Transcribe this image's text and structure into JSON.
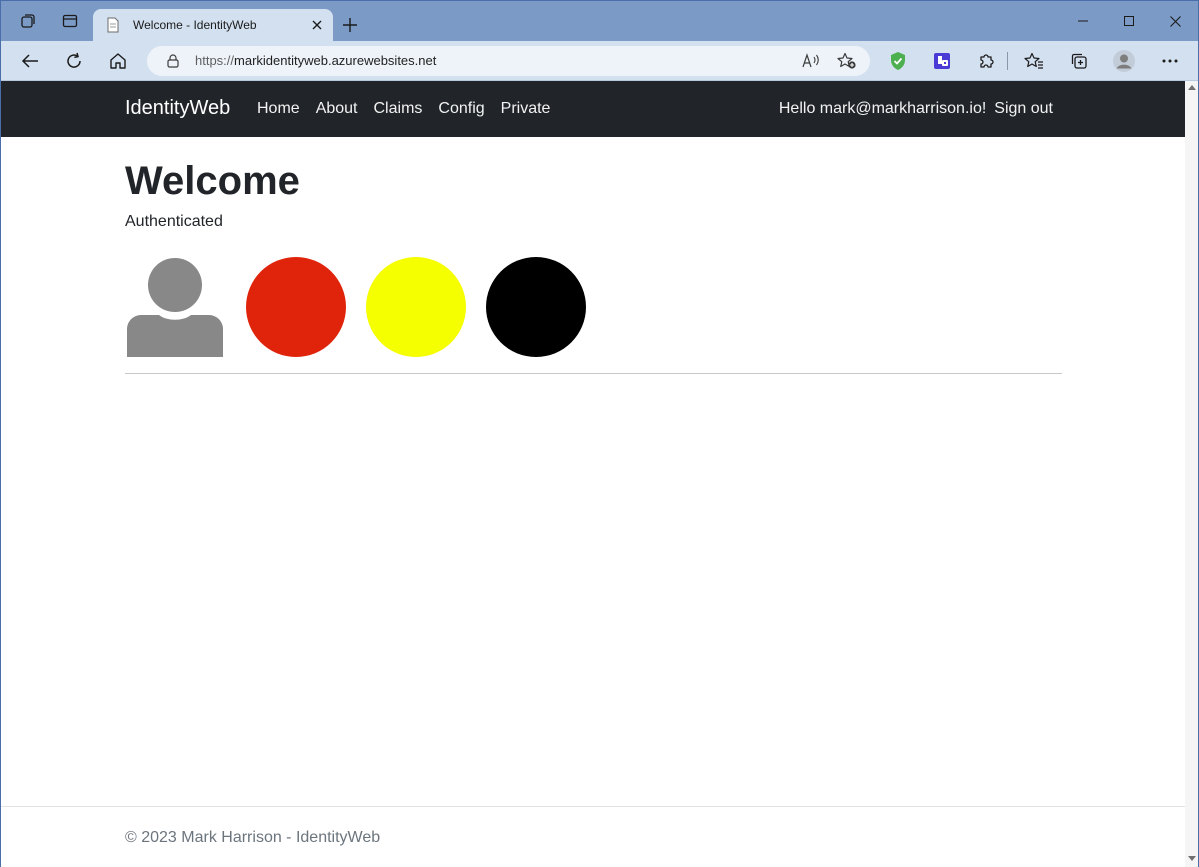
{
  "browser": {
    "tab_title": "Welcome - IdentityWeb",
    "url_host": "markidentityweb.azurewebsites.net",
    "url_scheme": "https://"
  },
  "site": {
    "brand": "IdentityWeb",
    "nav": [
      "Home",
      "About",
      "Claims",
      "Config",
      "Private"
    ],
    "greeting": "Hello mark@markharrison.io!",
    "sign_out": "Sign out"
  },
  "main": {
    "heading": "Welcome",
    "status": "Authenticated",
    "circles": [
      {
        "name": "red-circle",
        "color": "#e0240b"
      },
      {
        "name": "yellow-circle",
        "color": "#f5ff00"
      },
      {
        "name": "black-circle",
        "color": "#000000"
      }
    ],
    "avatar_color": "#888888"
  },
  "footer": {
    "text": "© 2023 Mark Harrison - IdentityWeb"
  }
}
